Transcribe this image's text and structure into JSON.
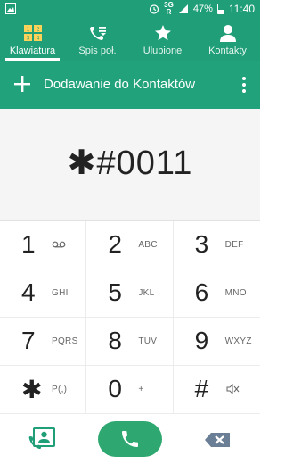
{
  "status_bar": {
    "network": "3G",
    "roaming": "R",
    "battery": "47%",
    "time": "11:40"
  },
  "tabs": [
    {
      "label": "Klawiatura",
      "icon": "keypad-grid-icon",
      "icon_text": [
        "1",
        "2",
        "3",
        "4"
      ],
      "active": true
    },
    {
      "label": "Spis poł.",
      "icon": "call-log-icon",
      "active": false
    },
    {
      "label": "Ulubione",
      "icon": "star-icon",
      "active": false
    },
    {
      "label": "Kontakty",
      "icon": "person-icon",
      "active": false
    }
  ],
  "add_bar": {
    "label": "Dodawanie do Kontaktów"
  },
  "display": {
    "number": "✱#0011"
  },
  "keys": [
    {
      "digit": "1",
      "sub": "",
      "sub_icon": "voicemail-icon"
    },
    {
      "digit": "2",
      "sub": "ABC"
    },
    {
      "digit": "3",
      "sub": "DEF"
    },
    {
      "digit": "4",
      "sub": "GHI"
    },
    {
      "digit": "5",
      "sub": "JKL"
    },
    {
      "digit": "6",
      "sub": "MNO"
    },
    {
      "digit": "7",
      "sub": "PQRS"
    },
    {
      "digit": "8",
      "sub": "TUV"
    },
    {
      "digit": "9",
      "sub": "WXYZ"
    },
    {
      "digit": "✱",
      "sub": "P(,)"
    },
    {
      "digit": "0",
      "sub": "+"
    },
    {
      "digit": "#",
      "sub": "",
      "sub_icon": "mute-icon"
    }
  ],
  "colors": {
    "primary": "#1f9e77",
    "call_button": "#2ea870",
    "backspace": "#6a7f96"
  }
}
